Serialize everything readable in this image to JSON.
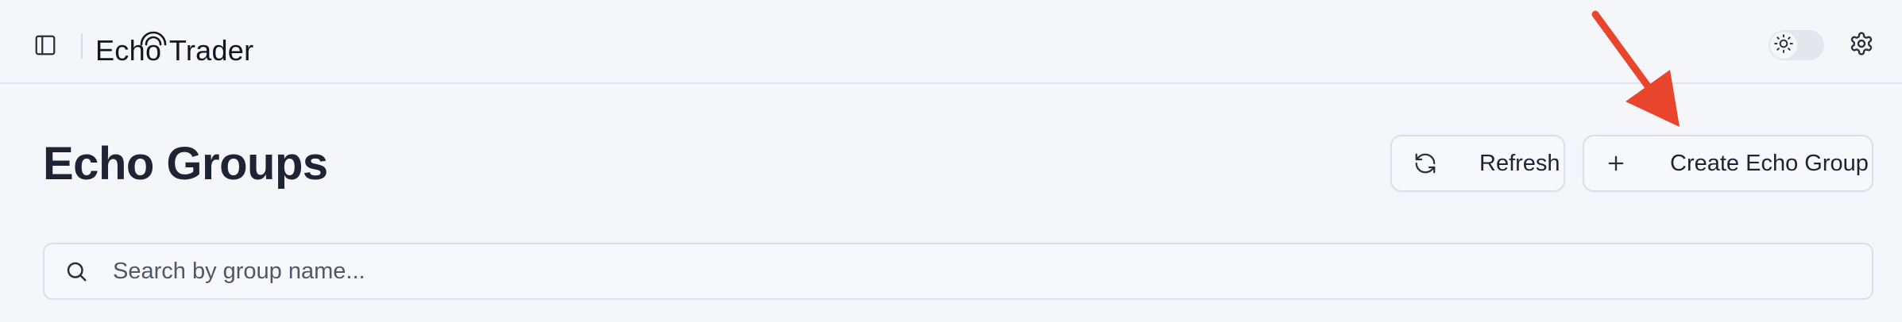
{
  "app": {
    "brand_name_part1": "Ech",
    "brand_name_o": "o",
    "brand_name_part2": " Trader"
  },
  "header": {
    "sidebar_toggle_icon": "sidebar-panel-icon",
    "theme_toggle_icon": "sun-icon",
    "settings_icon": "gear-icon"
  },
  "page": {
    "title": "Echo Groups"
  },
  "toolbar": {
    "refresh_label": "Refresh",
    "refresh_icon": "refresh-icon",
    "create_label": "Create Echo Group",
    "create_icon": "plus-icon"
  },
  "search": {
    "placeholder": "Search by group name...",
    "value": "",
    "icon": "search-icon"
  },
  "colors": {
    "background": "#f5f6fa",
    "text": "#1e2433",
    "border": "#dcdfe6",
    "annotation_arrow": "#e8452c"
  }
}
